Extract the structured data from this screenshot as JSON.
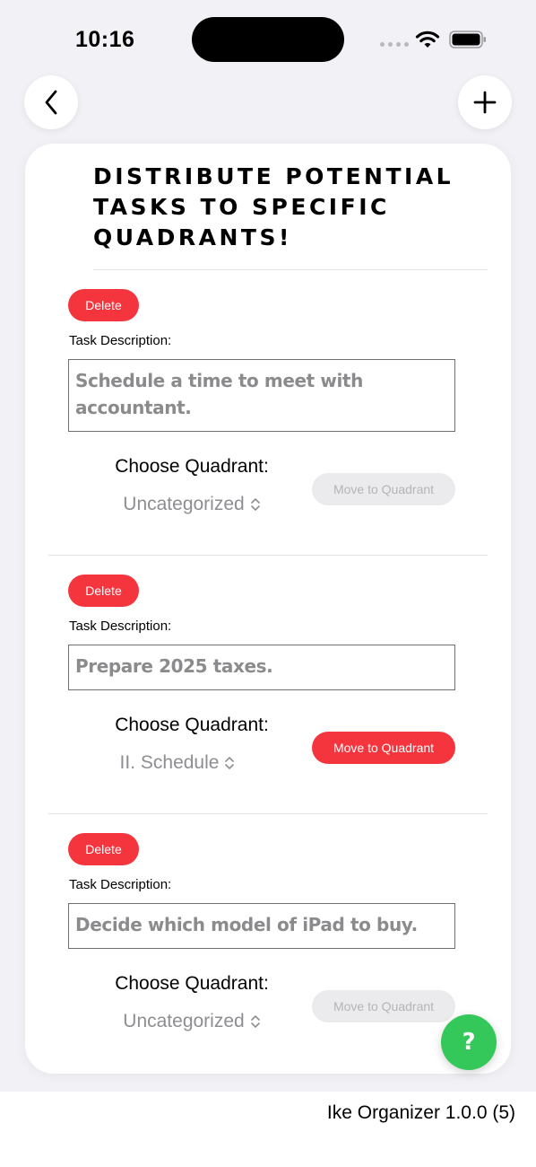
{
  "status_bar": {
    "time": "10:16"
  },
  "nav": {
    "back_icon": "chevron-left-icon",
    "add_icon": "plus-icon"
  },
  "page": {
    "title": "Distribute potential tasks to specific quadrants!"
  },
  "tasks": [
    {
      "delete_label": "Delete",
      "description_label": "Task Description:",
      "description": "Schedule a time to meet with accountant.",
      "choose_label": "Choose Quadrant:",
      "quadrant": "Uncategorized",
      "move_label": "Move to Quadrant",
      "move_enabled": false
    },
    {
      "delete_label": "Delete",
      "description_label": "Task Description:",
      "description": "Prepare 2025 taxes.",
      "choose_label": "Choose Quadrant:",
      "quadrant": "II. Schedule",
      "move_label": "Move to Quadrant",
      "move_enabled": true
    },
    {
      "delete_label": "Delete",
      "description_label": "Task Description:",
      "description": "Decide which model of iPad to buy.",
      "choose_label": "Choose Quadrant:",
      "quadrant": "Uncategorized",
      "move_label": "Move to Quadrant",
      "move_enabled": false
    }
  ],
  "help": {
    "label": "?"
  },
  "footer": {
    "version": "Ike Organizer 1.0.0 (5)"
  },
  "colors": {
    "accent_red": "#f5353d",
    "help_green": "#34c759",
    "background": "#f1f1f6"
  }
}
